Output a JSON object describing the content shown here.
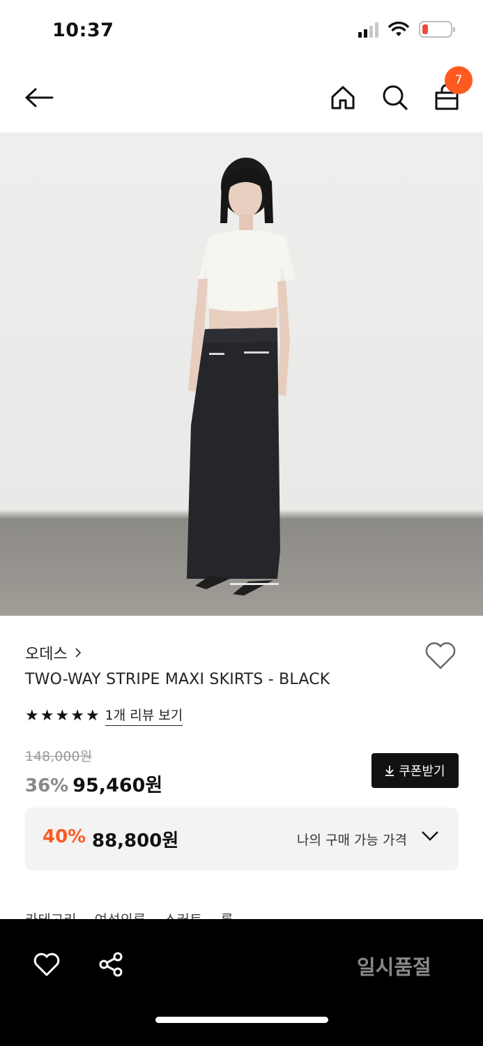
{
  "status_bar": {
    "time": "10:37"
  },
  "nav": {
    "back_icon": "arrow-left-icon",
    "home_icon": "home-icon",
    "search_icon": "search-icon",
    "cart_icon": "shopping-bag-icon",
    "cart_count": "7"
  },
  "product": {
    "brand": "오데스",
    "title": "TWO-WAY STRIPE MAXI SKIRTS - BLACK",
    "rating_stars": 5,
    "review_link": "1개 리뷰 보기",
    "original_price": "148,000원",
    "discount_rate": "36%",
    "sale_price": "95,460원",
    "coupon_button": "쿠폰받기",
    "my_price": {
      "discount_rate": "40%",
      "price": "88,800원",
      "label": "나의 구매 가능 가격"
    },
    "category": {
      "label": "카테고리",
      "path": [
        "여성의류",
        "스커트",
        "롱"
      ]
    }
  },
  "bottom_bar": {
    "wishlist_icon": "heart-icon",
    "share_icon": "share-icon",
    "status_button": "일시품절"
  },
  "colors": {
    "accent": "#ff5a1f",
    "dark": "#111111"
  }
}
